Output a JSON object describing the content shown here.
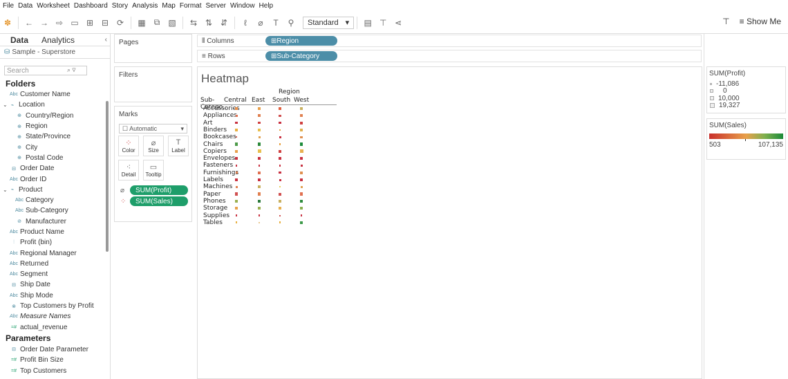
{
  "menu": [
    "File",
    "Data",
    "Worksheet",
    "Dashboard",
    "Story",
    "Analysis",
    "Map",
    "Format",
    "Server",
    "Window",
    "Help"
  ],
  "toolbar": {
    "fit_mode": "Standard",
    "show_me": "Show Me"
  },
  "left": {
    "tabs": [
      "Data",
      "Analytics"
    ],
    "datasource": "Sample - Superstore",
    "search_placeholder": "Search",
    "folders_label": "Folders",
    "parameters_label": "Parameters",
    "fields": [
      {
        "label": "Customer Name",
        "icon": "Abc",
        "level": 0
      },
      {
        "label": "Location",
        "icon": "hier",
        "level": 0,
        "twist": "v"
      },
      {
        "label": "Country/Region",
        "icon": "globe",
        "level": 1
      },
      {
        "label": "Region",
        "icon": "globe",
        "level": 1
      },
      {
        "label": "State/Province",
        "icon": "globe",
        "level": 1
      },
      {
        "label": "City",
        "icon": "globe",
        "level": 1
      },
      {
        "label": "Postal Code",
        "icon": "globe",
        "level": 1
      },
      {
        "label": "Order Date",
        "icon": "date",
        "level": 0
      },
      {
        "label": "Order ID",
        "icon": "Abc",
        "level": 0
      },
      {
        "label": "Product",
        "icon": "hier",
        "level": 0,
        "twist": "v"
      },
      {
        "label": "Category",
        "icon": "Abc",
        "level": 1
      },
      {
        "label": "Sub-Category",
        "icon": "Abc",
        "level": 1
      },
      {
        "label": "Manufacturer",
        "icon": "group",
        "level": 1
      },
      {
        "label": "Product Name",
        "icon": "Abc",
        "level": 0
      },
      {
        "label": "Profit (bin)",
        "icon": "bin",
        "level": 0
      },
      {
        "label": "Regional Manager",
        "icon": "Abc",
        "level": 0
      },
      {
        "label": "Returned",
        "icon": "Abc",
        "level": 0
      },
      {
        "label": "Segment",
        "icon": "Abc",
        "level": 0
      },
      {
        "label": "Ship Date",
        "icon": "date",
        "level": 0
      },
      {
        "label": "Ship Mode",
        "icon": "Abc",
        "level": 0
      },
      {
        "label": "Top Customers by Profit",
        "icon": "set",
        "level": 0
      },
      {
        "label": "Measure Names",
        "icon": "Abc",
        "level": 0,
        "italic": true
      },
      {
        "label": "actual_revenue",
        "icon": "num",
        "level": 0
      }
    ],
    "parameters": [
      {
        "label": "Order Date Parameter",
        "icon": "date"
      },
      {
        "label": "Profit Bin Size",
        "icon": "num"
      },
      {
        "label": "Top Customers",
        "icon": "num"
      }
    ]
  },
  "cards": {
    "pages": "Pages",
    "filters": "Filters",
    "marks": "Marks",
    "marks_type": "Automatic",
    "mark_buttons": [
      "Color",
      "Size",
      "Label",
      "Detail",
      "Tooltip"
    ],
    "pills": [
      "SUM(Profit)",
      "SUM(Sales)"
    ]
  },
  "shelves": {
    "columns_label": "Columns",
    "columns_pill": "Region",
    "rows_label": "Rows",
    "rows_pill": "Sub-Category"
  },
  "view": {
    "title": "Heatmap"
  },
  "chart_data": {
    "type": "heatmap",
    "title": "Heatmap",
    "column_header": "Region",
    "row_header": "Sub-Catego..",
    "columns": [
      "Central",
      "East",
      "South",
      "West"
    ],
    "rows": [
      "Accessories",
      "Appliances",
      "Art",
      "Binders",
      "Bookcases",
      "Chairs",
      "Copiers",
      "Envelopes",
      "Fasteners",
      "Furnishings",
      "Labels",
      "Machines",
      "Paper",
      "Phones",
      "Storage",
      "Supplies",
      "Tables"
    ],
    "size_measure": "SUM(Profit)",
    "color_measure": "SUM(Sales)",
    "cell_colors": [
      [
        "#e8904a",
        "#e8a04a",
        "#e06040",
        "#c8b060"
      ],
      [
        "#e07050",
        "#e08050",
        "#d05050",
        "#e08050"
      ],
      [
        "#c83040",
        "#d04040",
        "#c83040",
        "#d04040"
      ],
      [
        "#e8b040",
        "#e8c050",
        "#e8a040",
        "#e0b050"
      ],
      [
        "#d06050",
        "#e0a050",
        "#c83040",
        "#e09050"
      ],
      [
        "#4c9a48",
        "#2c8a3c",
        "#e8a040",
        "#1c8b3a"
      ],
      [
        "#e8a04a",
        "#e8c050",
        "#d04040",
        "#e8b050"
      ],
      [
        "#c83040",
        "#c83040",
        "#c83040",
        "#c83040"
      ],
      [
        "#c83040",
        "#c83040",
        "#c83040",
        "#c83040"
      ],
      [
        "#e08050",
        "#e07050",
        "#c83040",
        "#e09050"
      ],
      [
        "#c83040",
        "#c83040",
        "#c83040",
        "#c83040"
      ],
      [
        "#e08050",
        "#c8b060",
        "#e8d060",
        "#e0a050"
      ],
      [
        "#d05050",
        "#e08050",
        "#d05050",
        "#e07050"
      ],
      [
        "#9ab050",
        "#2c7a3c",
        "#c8b060",
        "#2c8a3c"
      ],
      [
        "#e8a04a",
        "#9ab050",
        "#e8b050",
        "#8ab050"
      ],
      [
        "#c83040",
        "#c83040",
        "#d05050",
        "#c83040"
      ],
      [
        "#e8b040",
        "#e8c890",
        "#e8b040",
        "#3c9a48"
      ]
    ],
    "cell_sizes": [
      [
        0.85,
        0.9,
        0.7,
        0.95
      ],
      [
        0.6,
        0.8,
        0.65,
        0.85
      ],
      [
        0.7,
        0.75,
        0.65,
        0.8
      ],
      [
        0.7,
        0.9,
        0.5,
        0.95
      ],
      [
        0.5,
        0.6,
        0.6,
        0.65
      ],
      [
        0.9,
        0.9,
        0.5,
        0.95
      ],
      [
        0.9,
        1.0,
        0.9,
        1.0
      ],
      [
        0.75,
        0.75,
        0.7,
        0.8
      ],
      [
        0.55,
        0.55,
        0.5,
        0.6
      ],
      [
        0.6,
        0.85,
        0.7,
        0.85
      ],
      [
        0.65,
        0.7,
        0.6,
        0.75
      ],
      [
        0.6,
        0.8,
        0.45,
        0.6
      ],
      [
        0.85,
        0.85,
        0.8,
        0.9
      ],
      [
        0.9,
        0.95,
        0.85,
        0.95
      ],
      [
        0.7,
        0.85,
        0.7,
        0.85
      ],
      [
        0.5,
        0.5,
        0.4,
        0.5
      ],
      [
        0.55,
        0.3,
        0.55,
        0.7
      ]
    ]
  },
  "legends": {
    "profit": {
      "title": "SUM(Profit)",
      "items": [
        "-11,086",
        "0",
        "10,000",
        "19,327"
      ]
    },
    "sales": {
      "title": "SUM(Sales)",
      "min": "503",
      "max": "107,135"
    }
  }
}
